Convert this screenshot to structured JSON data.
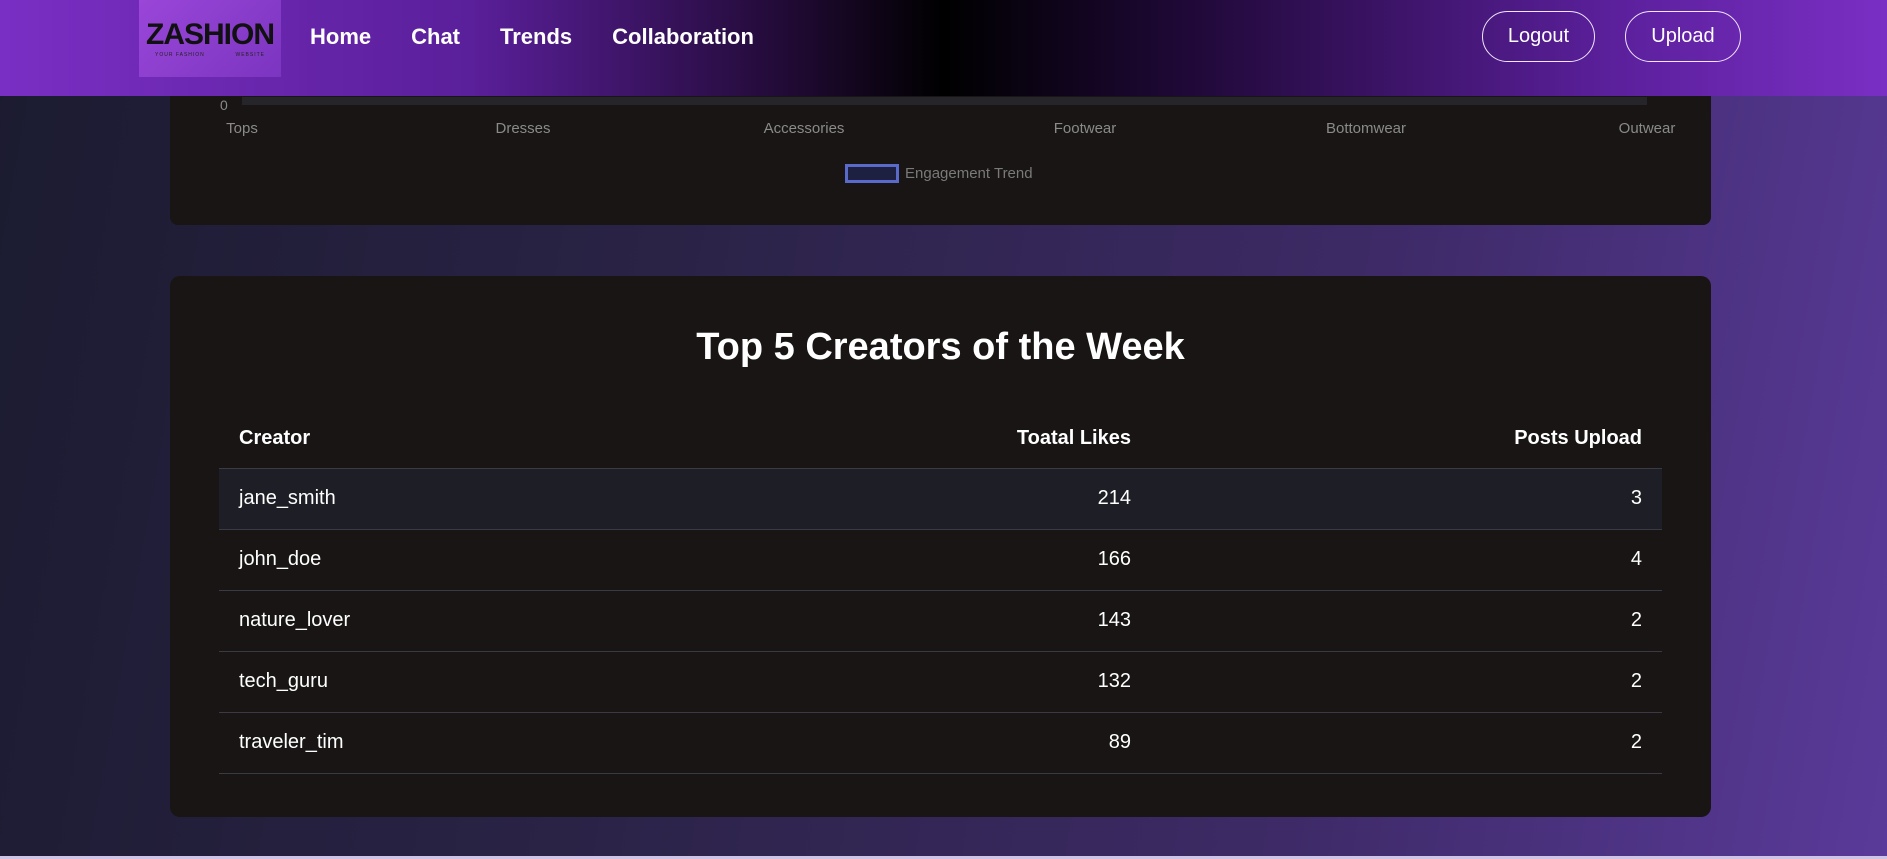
{
  "nav": {
    "logo_text": "ZASHION",
    "logo_sub_left": "YOUR FASHION",
    "logo_sub_right": "WEBSITE",
    "links": [
      "Home",
      "Chat",
      "Trends",
      "Collaboration"
    ],
    "logout_label": "Logout",
    "upload_label": "Upload"
  },
  "chart_data": {
    "type": "line",
    "categories": [
      "Tops",
      "Dresses",
      "Accessories",
      "Footwear",
      "Bottomwear",
      "Outwear"
    ],
    "y_tick_visible": "0",
    "series": [
      {
        "name": "Engagement Trend",
        "values": [
          0,
          0,
          0,
          0,
          0,
          0
        ]
      }
    ],
    "legend_placement": "bottom-center"
  },
  "creators": {
    "title": "Top 5 Creators of the Week",
    "headers": [
      "Creator",
      "Toatal Likes",
      "Posts Upload"
    ],
    "rows": [
      {
        "creator": "jane_smith",
        "likes": "214",
        "posts": "3"
      },
      {
        "creator": "john_doe",
        "likes": "166",
        "posts": "4"
      },
      {
        "creator": "nature_lover",
        "likes": "143",
        "posts": "2"
      },
      {
        "creator": "tech_guru",
        "likes": "132",
        "posts": "2"
      },
      {
        "creator": "traveler_tim",
        "likes": "89",
        "posts": "2"
      }
    ]
  },
  "colors": {
    "accent_purple": "#7a2fc4",
    "card_bg": "#181514",
    "legend_border": "#5a6acb"
  }
}
